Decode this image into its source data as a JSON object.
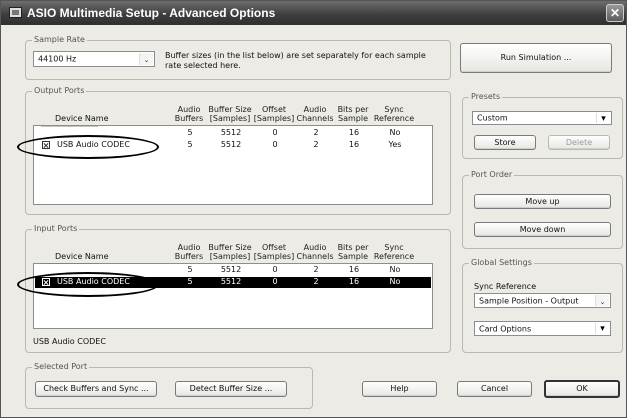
{
  "window": {
    "title": "ASIO Multimedia Setup  - Advanced Options",
    "close_glyph": "✕"
  },
  "sample_rate": {
    "group_label": "Sample Rate",
    "selected": "44100 Hz",
    "note": "Buffer sizes (in the list below) are set separately for each sample rate selected here."
  },
  "run_simulation_label": "Run Simulation ...",
  "columns": {
    "device_name": "Device Name",
    "audio_buffers": [
      "Audio",
      "Buffers"
    ],
    "buffer_size": [
      "Buffer Size",
      "[Samples]"
    ],
    "offset": [
      "Offset",
      "[Samples]"
    ],
    "audio_channels": [
      "Audio",
      "Channels"
    ],
    "bits_per_sample": [
      "Bits per",
      "Sample"
    ],
    "sync_reference": [
      "Sync",
      "Reference"
    ]
  },
  "output_ports": {
    "group_label": "Output Ports",
    "truncated_row_text": "‾‾‾‾‾‾‾‾‾‾‾‾‾‾‾‾‾‾‾",
    "truncated_row": {
      "buffers": "5",
      "size": "5512",
      "offset": "0",
      "channels": "2",
      "bits": "16",
      "sync": "No"
    },
    "row": {
      "name": "USB Audio CODEC",
      "buffers": "5",
      "size": "5512",
      "offset": "0",
      "channels": "2",
      "bits": "16",
      "sync": "Yes"
    }
  },
  "input_ports": {
    "group_label": "Input Ports",
    "truncated_row_text": "‾‾‾‾‾‾‾‾‾‾‾‾‾‾‾‾‾‾‾",
    "truncated_row": {
      "buffers": "5",
      "size": "5512",
      "offset": "0",
      "channels": "2",
      "bits": "16",
      "sync": "No"
    },
    "row": {
      "name": "USB Audio CODEC",
      "buffers": "5",
      "size": "5512",
      "offset": "0",
      "channels": "2",
      "bits": "16",
      "sync": "No"
    },
    "footer_device": "USB Audio CODEC"
  },
  "presets": {
    "group_label": "Presets",
    "selected": "Custom",
    "store_label": "Store",
    "delete_label": "Delete"
  },
  "port_order": {
    "group_label": "Port Order",
    "move_up_label": "Move up",
    "move_down_label": "Move down"
  },
  "global_settings": {
    "group_label": "Global Settings",
    "sync_reference_label": "Sync Reference",
    "sync_reference_selected": "Sample Position - Output",
    "card_options_selected": "Card Options"
  },
  "selected_port": {
    "group_label": "Selected Port",
    "check_buffers_label": "Check Buffers and Sync ...",
    "detect_buffer_label": "Detect Buffer Size ..."
  },
  "footer": {
    "help_label": "Help",
    "cancel_label": "Cancel",
    "ok_label": "OK"
  },
  "icons": {
    "dropdown_arrow": "⌄",
    "dropdown_arrow_black": "▾"
  }
}
